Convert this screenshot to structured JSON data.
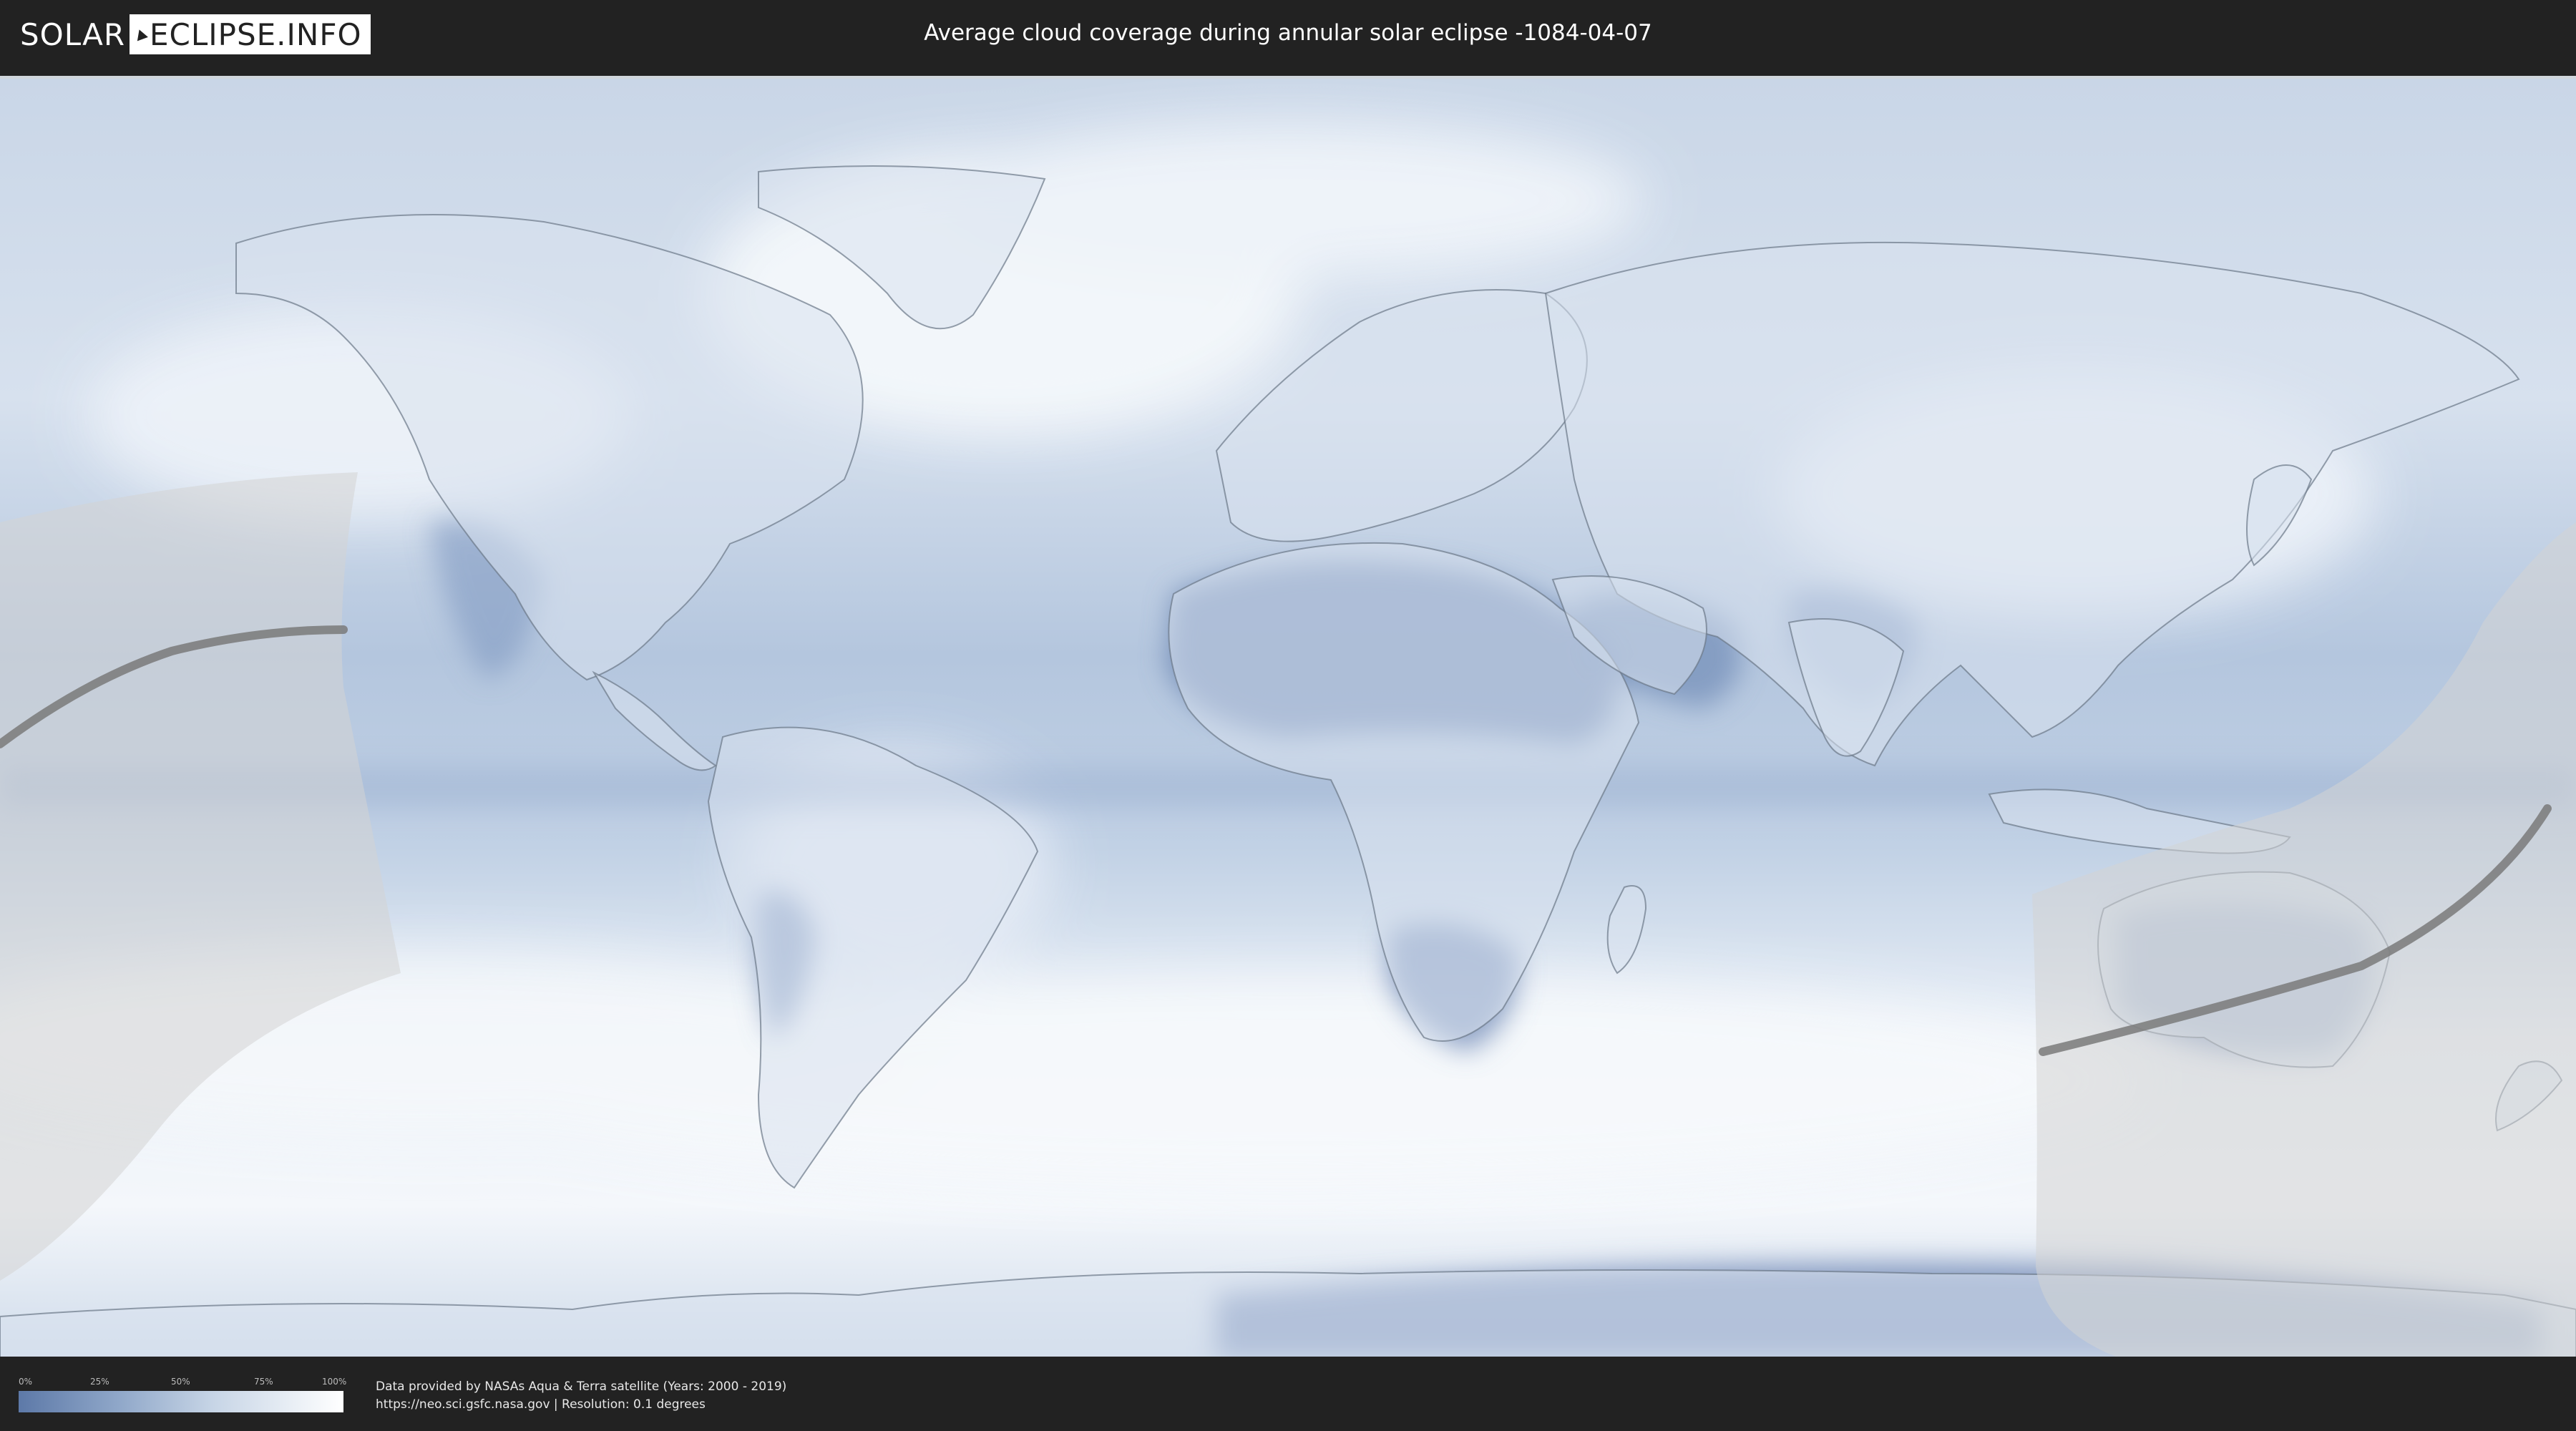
{
  "header": {
    "logo_left": "SOLAR",
    "logo_right": "ECLIPSE.INFO",
    "title": "Average cloud coverage during annular solar eclipse -1084-04-07"
  },
  "legend": {
    "ticks": [
      "0%",
      "25%",
      "50%",
      "75%",
      "100%"
    ],
    "colors": {
      "low": "#5d79a8",
      "high": "#ffffff"
    }
  },
  "footer": {
    "credit_line": "Data provided by NASAs Aqua & Terra satellite (Years: 2000 - 2019)",
    "source_line": "https://neo.sci.gsfc.nasa.gov | Resolution: 0.1 degrees"
  },
  "map": {
    "colors": {
      "ocean_clear": "#9fb4d2",
      "cloud": "#f3f6fa",
      "land_dry": "#6f88b5",
      "eclipse_zone": "#d9d9d9",
      "path_line": "#7a7a7a",
      "border": "#6b7787"
    }
  }
}
